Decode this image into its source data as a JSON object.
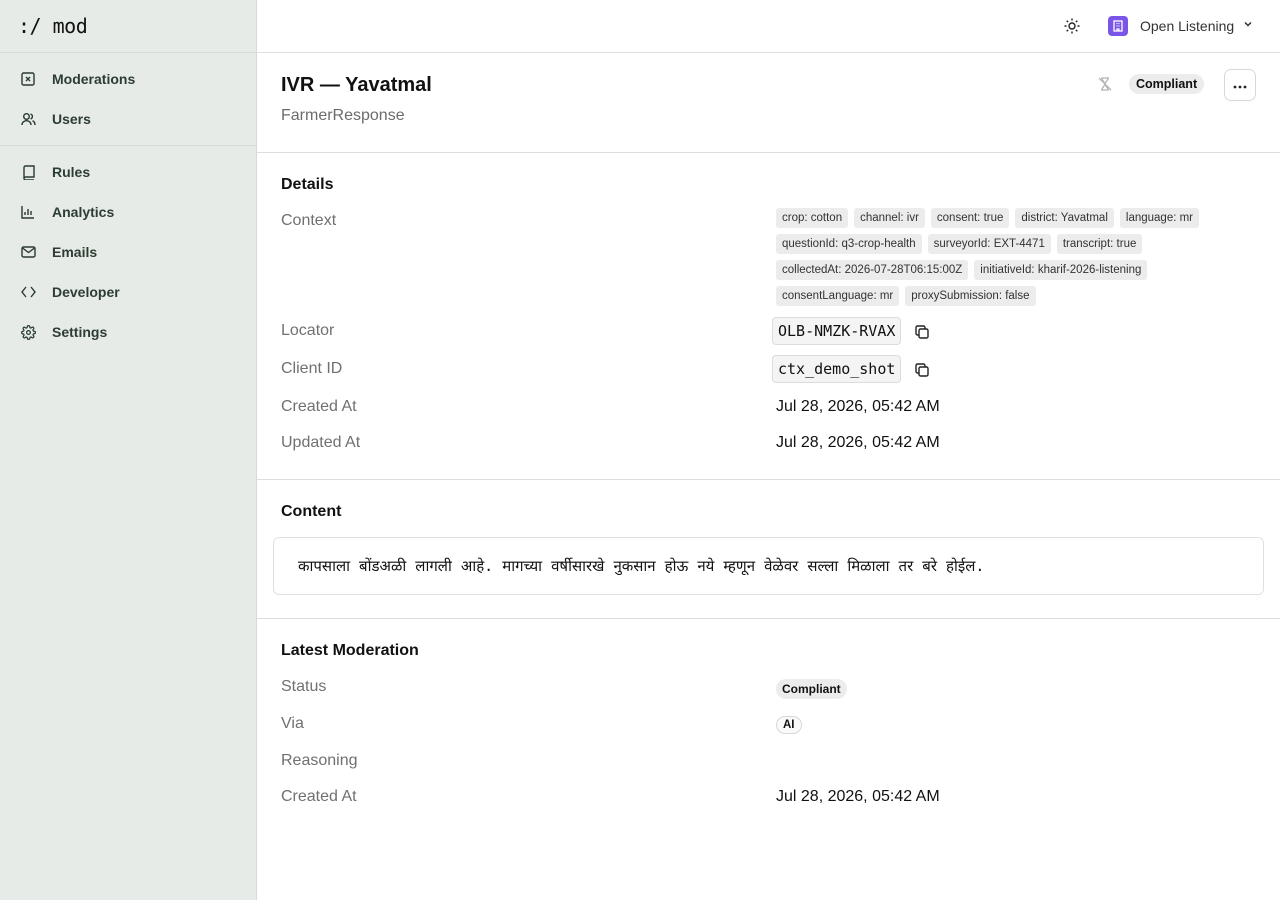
{
  "app": {
    "logo": ":/ mod"
  },
  "sidebar": {
    "items": [
      {
        "label": "Moderations",
        "icon": "moderation-icon"
      },
      {
        "label": "Users",
        "icon": "users-icon"
      },
      {
        "label": "Rules",
        "icon": "book-icon"
      },
      {
        "label": "Analytics",
        "icon": "chart-icon"
      },
      {
        "label": "Emails",
        "icon": "mail-icon"
      },
      {
        "label": "Developer",
        "icon": "code-icon"
      },
      {
        "label": "Settings",
        "icon": "gear-icon"
      }
    ]
  },
  "topbar": {
    "org_name": "Open Listening",
    "brand_color": "#7a55e8"
  },
  "header": {
    "title": "IVR — Yavatmal",
    "subtitle": "FarmerResponse",
    "status_badge": "Compliant"
  },
  "details": {
    "section_title": "Details",
    "context_label": "Context",
    "context_tags": [
      "crop: cotton",
      "channel: ivr",
      "consent: true",
      "district: Yavatmal",
      "language: mr",
      "questionId: q3-crop-health",
      "surveyorId: EXT-4471",
      "transcript: true",
      "collectedAt: 2026-07-28T06:15:00Z",
      "initiativeId: kharif-2026-listening",
      "consentLanguage: mr",
      "proxySubmission: false"
    ],
    "locator_label": "Locator",
    "locator_value": "OLB-NMZK-RVAX",
    "client_id_label": "Client ID",
    "client_id_value": "ctx_demo_shot",
    "created_at_label": "Created At",
    "created_at_value": "Jul 28, 2026, 05:42 AM",
    "updated_at_label": "Updated At",
    "updated_at_value": "Jul 28, 2026, 05:42 AM"
  },
  "content": {
    "section_title": "Content",
    "text": "कापसाला बोंडअळी लागली आहे. मागच्या वर्षीसारखे नुकसान होऊ नये म्हणून वेळेवर सल्ला मिळाला तर बरे होईल."
  },
  "latest_moderation": {
    "section_title": "Latest Moderation",
    "status_label": "Status",
    "status_value": "Compliant",
    "via_label": "Via",
    "via_value": "AI",
    "reasoning_label": "Reasoning",
    "created_at_label": "Created At",
    "created_at_value": "Jul 28, 2026, 05:42 AM"
  }
}
